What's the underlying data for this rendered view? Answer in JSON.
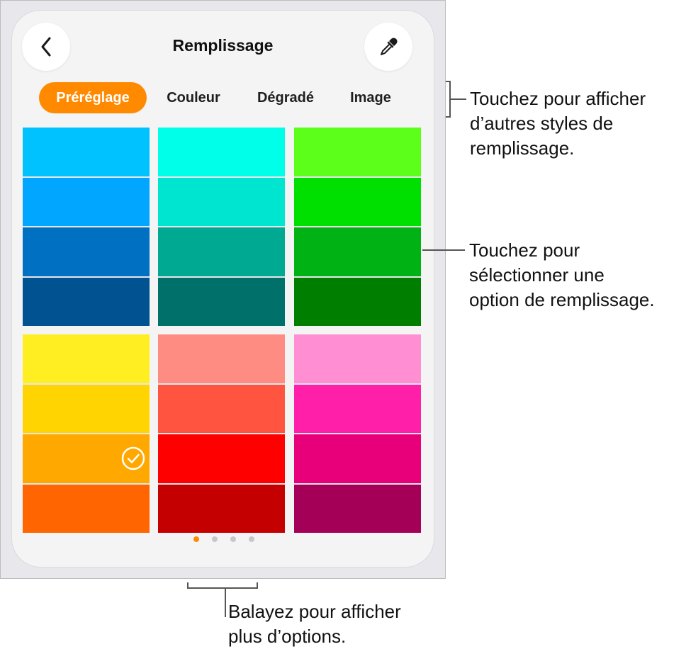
{
  "header": {
    "title": "Remplissage",
    "back_icon": "chevron-left-icon",
    "picker_icon": "eyedropper-icon"
  },
  "tabs": [
    {
      "label": "Préréglage",
      "active": true
    },
    {
      "label": "Couleur",
      "active": false
    },
    {
      "label": "Dégradé",
      "active": false
    },
    {
      "label": "Image",
      "active": false
    }
  ],
  "colors": {
    "accent": "#ff8a00"
  },
  "swatch_columns": [
    {
      "colors": [
        "#00c2ff",
        "#00a6ff",
        "#0071c2",
        "#005290"
      ]
    },
    {
      "colors": [
        "#00ffe8",
        "#00e5d0",
        "#00a992",
        "#00706a"
      ]
    },
    {
      "colors": [
        "#5cff1a",
        "#00e000",
        "#00b213",
        "#007e00"
      ]
    },
    {
      "colors": [
        "#ffee22",
        "#ffd400",
        "#ffa800",
        "#ff6500"
      ]
    },
    {
      "colors": [
        "#ff8c82",
        "#ff5540",
        "#ff0000",
        "#c40000"
      ]
    },
    {
      "colors": [
        "#ff8fd2",
        "#ff1fa8",
        "#e8007a",
        "#a40057"
      ]
    }
  ],
  "selected_swatch": {
    "column": 3,
    "row": 2
  },
  "pagination": {
    "total": 4,
    "current": 1
  },
  "callouts": {
    "tabs": [
      "Touchez pour afficher",
      "d’autres styles de",
      "remplissage."
    ],
    "swatches": [
      "Touchez pour",
      "sélectionner une",
      "option de remplissage."
    ],
    "pages": [
      "Balayez pour afficher",
      "plus d’options."
    ]
  }
}
